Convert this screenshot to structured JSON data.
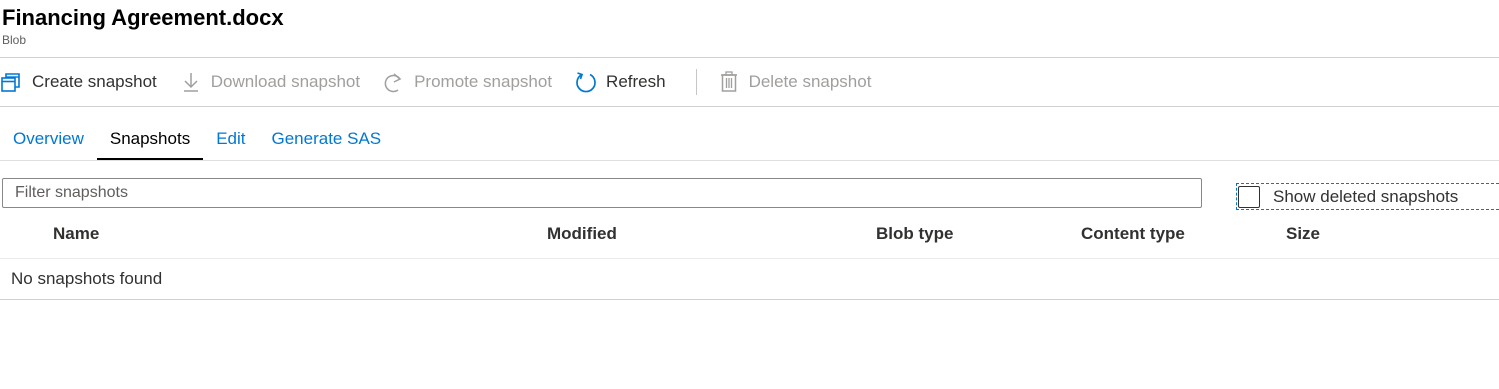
{
  "header": {
    "title": "Financing Agreement.docx",
    "subtitle": "Blob"
  },
  "toolbar": {
    "create_snapshot": "Create snapshot",
    "download_snapshot": "Download snapshot",
    "promote_snapshot": "Promote snapshot",
    "refresh": "Refresh",
    "delete_snapshot": "Delete snapshot"
  },
  "tabs": [
    {
      "label": "Overview",
      "selected": false
    },
    {
      "label": "Snapshots",
      "selected": true
    },
    {
      "label": "Edit",
      "selected": false
    },
    {
      "label": "Generate SAS",
      "selected": false
    }
  ],
  "filter": {
    "placeholder": "Filter snapshots",
    "value": ""
  },
  "show_deleted": {
    "label": "Show deleted snapshots",
    "checked": false
  },
  "table": {
    "columns": [
      "Name",
      "Modified",
      "Blob type",
      "Content type",
      "Size"
    ],
    "empty_message": "No snapshots found"
  },
  "colors": {
    "accent": "#0078d4",
    "disabled": "#a19f9d",
    "text": "#323130"
  },
  "icons": {
    "create_snapshot": "copy-stack-icon",
    "download_snapshot": "download-icon",
    "promote_snapshot": "redo-icon",
    "refresh": "refresh-icon",
    "delete_snapshot": "trash-icon"
  }
}
